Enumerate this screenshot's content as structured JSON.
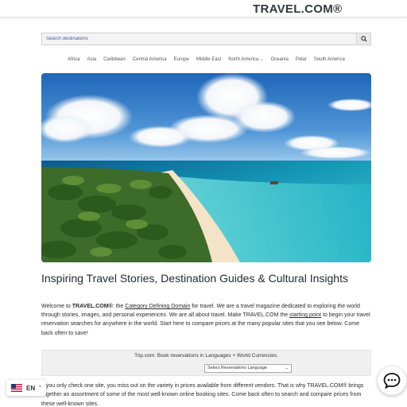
{
  "header": {
    "logo": "TRAVEL.COM®"
  },
  "search": {
    "placeholder": "Search destinations",
    "icon": "search-icon"
  },
  "nav": {
    "items": [
      {
        "label": "Africa"
      },
      {
        "label": "Asia"
      },
      {
        "label": "Caribbean"
      },
      {
        "label": "Central America"
      },
      {
        "label": "Europe"
      },
      {
        "label": "Middle East"
      },
      {
        "label": "North America",
        "has_dropdown": true
      },
      {
        "label": "Oceania"
      },
      {
        "label": "Polar"
      },
      {
        "label": "South America"
      }
    ]
  },
  "hero": {
    "alt": "Tropical beach with palm trees and turquoise water"
  },
  "main": {
    "headline": "Inspiring Travel Stories, Destination Guides & Cultural Insights",
    "intro": {
      "p1": "Welcome to ",
      "brand": "TRAVEL.COM®",
      "p2": ": the ",
      "link1": "Category Defining Domain",
      "p3": " for travel. We are a travel magazine dedicated to exploring the world through stories, images, and personal experiences. We are all about travel. Make TRAVEL.COM the ",
      "link2": "starting point",
      "p4": " to begin your travel reservation searches for anywhere in the world. Start here to compare prices at the many popular sites that you see below. Come back often to save!"
    },
    "booking": {
      "title": "Trip.com: Book reservations in Languages + World Currencies.",
      "select_value": "Select Reservations Language"
    },
    "para2": "If you only check one site, you miss out on the variety in prices available from different vendors. That is why TRAVEL.COM® brings together an assortment of some of the most well-known online booking sites. Come back often to search and compare prices from these well-known sites."
  },
  "language": {
    "code": "EN",
    "flag": "us-flag-icon"
  },
  "chat": {
    "icon": "chat-bubble-icon"
  },
  "colors": {
    "accent": "#3a5ea8",
    "text": "#2b2b2b",
    "heading": "#1e2a30"
  }
}
